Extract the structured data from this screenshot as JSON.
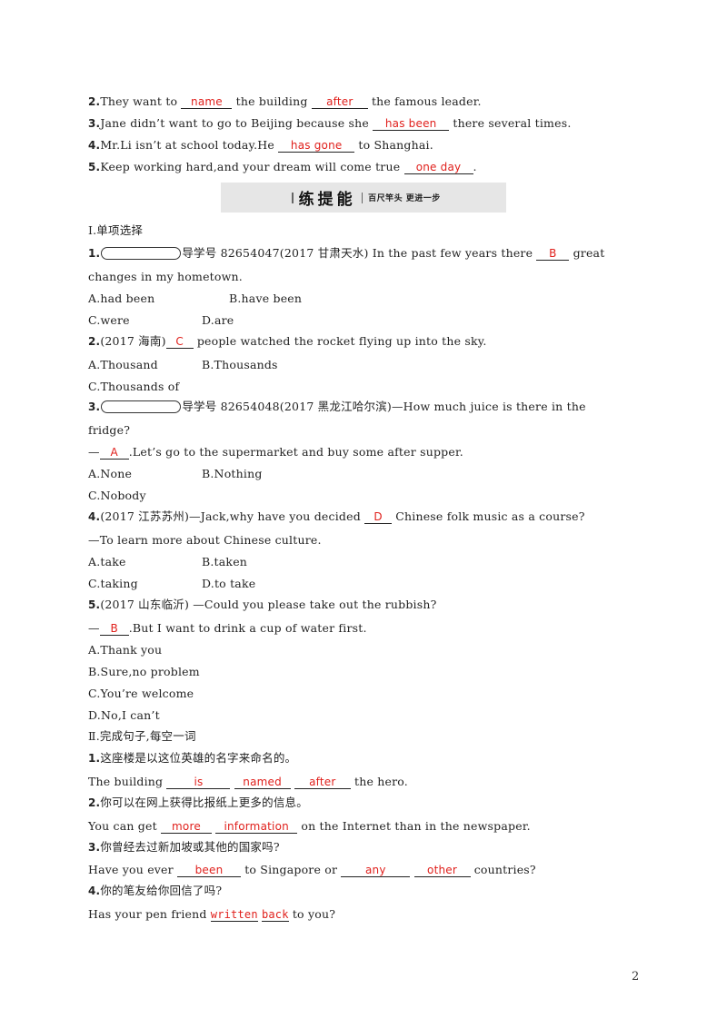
{
  "top_items": [
    {
      "num": "2.",
      "pre": "They want to ",
      "blanks": [
        "name",
        "after"
      ],
      "mid": " the building ",
      "post": " the famous leader."
    },
    {
      "num": "3.",
      "pre": "Jane didn’t want to go to Beijing because she ",
      "blanks": [
        "has been"
      ],
      "post": " there several times."
    },
    {
      "num": "4.",
      "pre": "Mr.Li isn’t at school today.He ",
      "blanks": [
        "has gone"
      ],
      "post": " to Shanghai."
    },
    {
      "num": "5.",
      "pre": "Keep working hard,and your dream will come true ",
      "blanks": [
        "one day"
      ],
      "post": "."
    }
  ],
  "banner": {
    "title": "练提能",
    "subtitle": "百尺竿头  更进一步"
  },
  "section1": {
    "heading": "Ⅰ.单项选择",
    "q1": {
      "num": "1.",
      "prefix": "导学号 82654047(2017 甘肃天水) In the past few years there ",
      "answer": "B",
      "suffix": " great",
      "cont": "changes in my hometown.",
      "options": [
        "A.had been",
        "B.have been",
        "C.were",
        "D.are"
      ]
    },
    "q2": {
      "num": "2.",
      "prefix": "(2017 海南)",
      "answer": "C",
      "suffix": " people watched the rocket flying up into the sky.",
      "options": [
        "A.Thousand",
        "B.Thousands",
        "C.Thousands of"
      ]
    },
    "q3": {
      "num": "3.",
      "prefix": "导学号 82654048(2017 黑龙江哈尔滨)—How much juice is there in the",
      "cont": "fridge?",
      "dash": "—",
      "answer": "A",
      "suffix": ".Let’s go to the supermarket and buy some after supper.",
      "options": [
        "A.None",
        "B.Nothing",
        "C.Nobody"
      ]
    },
    "q4": {
      "num": "4.",
      "prefix": "(2017 江苏苏州)—Jack,why have you decided ",
      "answer": "D",
      "suffix": " Chinese folk music as a course?",
      "reply": "—To learn more about Chinese culture.",
      "options": [
        "A.take",
        "B.taken",
        "C.taking",
        "D.to take"
      ]
    },
    "q5": {
      "num": "5.",
      "prefix": "(2017 山东临沂) —Could you please take out the rubbish?",
      "dash": "—",
      "answer": "B",
      "suffix": ".But I want to drink a cup of water first.",
      "options": [
        "A.Thank you",
        "B.Sure,no problem",
        "C.You’re welcome",
        "D.No,I can’t"
      ]
    }
  },
  "section2": {
    "heading": "Ⅱ.完成句子,每空一词",
    "items": [
      {
        "num": "1.",
        "chinese": "这座楼是以这位英雄的名字来命名的。",
        "pre": "The building ",
        "blanks": [
          "is",
          "named",
          "after"
        ],
        "post": " the hero."
      },
      {
        "num": "2.",
        "chinese": "你可以在网上获得比报纸上更多的信息。",
        "pre": "You can get ",
        "blanks": [
          "more",
          "information"
        ],
        "post": " on the Internet than in the newspaper."
      },
      {
        "num": "3.",
        "chinese": "你曾经去过新加坡或其他的国家吗?",
        "pre": "Have you ever ",
        "blanks": [
          "been",
          "any",
          "other"
        ],
        "mid": " to Singapore or ",
        "post": " countries?"
      },
      {
        "num": "4.",
        "chinese": "你的笔友给你回信了吗?",
        "pre": "Has your pen friend ",
        "blanks": [
          "written",
          "back"
        ],
        "post": " to you?"
      }
    ]
  },
  "page_number": "2",
  "colors": {
    "answer": "#e0201c",
    "banner_bg": "#e6e6e6",
    "text": "#222222"
  }
}
